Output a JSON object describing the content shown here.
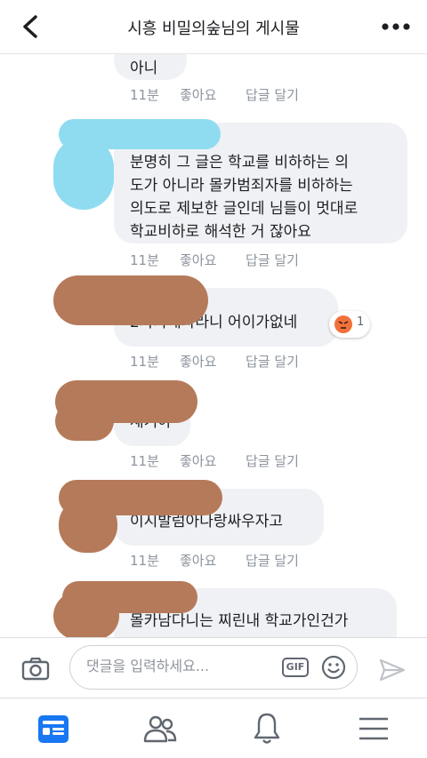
{
  "header": {
    "title": "시흥 비밀의숲님의 게시물",
    "back_icon": "chevron-left-icon",
    "more_icon": "more-horizontal-icon"
  },
  "comments": [
    {
      "text_lines": [
        "아니"
      ],
      "time": "11분",
      "like": "좋아요",
      "reply": "답글 달기",
      "reaction": null
    },
    {
      "text_lines": [
        "분명히 그 글은 학교를 비하하는 의",
        "도가 아니라 몰카범죄자를 비하하는",
        "의도로 제보한 글인데 님들이 멋대로",
        "학교비하로 해석한 거 잖아요"
      ],
      "time": "11분",
      "like": "좋아요",
      "reply": "답글 달기",
      "reaction": null
    },
    {
      "text_lines": [
        "2차가해자라니 어이가없네"
      ],
      "time": "11분",
      "like": "좋아요",
      "reply": "답글 달기",
      "reaction": {
        "icon": "angry-reaction-icon",
        "count": "1"
      }
    },
    {
      "text_lines": [
        "재기야"
      ],
      "time": "11분",
      "like": "좋아요",
      "reply": "답글 달기",
      "reaction": null
    },
    {
      "text_lines": [
        "이시발럼아나랑싸우자고"
      ],
      "time": "11분",
      "like": "좋아요",
      "reply": "답글 달기",
      "reaction": null
    },
    {
      "text_lines": [
        "몰카남다니는 찌린내 학교가인건가"
      ],
      "time": "",
      "like": "",
      "reply": "",
      "reaction": null
    }
  ],
  "composer": {
    "placeholder": "댓글을 입력하세요...",
    "gif_label": "GIF",
    "camera_icon": "camera-icon",
    "emoji_icon": "emoji-icon",
    "send_icon": "send-icon"
  },
  "tabbar": {
    "items": [
      "news-feed-icon",
      "friends-icon",
      "notifications-icon",
      "menu-icon"
    ],
    "active": "news-feed-icon",
    "accent": "#1877f2"
  },
  "colors": {
    "accent": "#1877f2",
    "bubble": "#f0f1f4",
    "meta": "#8d949e"
  }
}
